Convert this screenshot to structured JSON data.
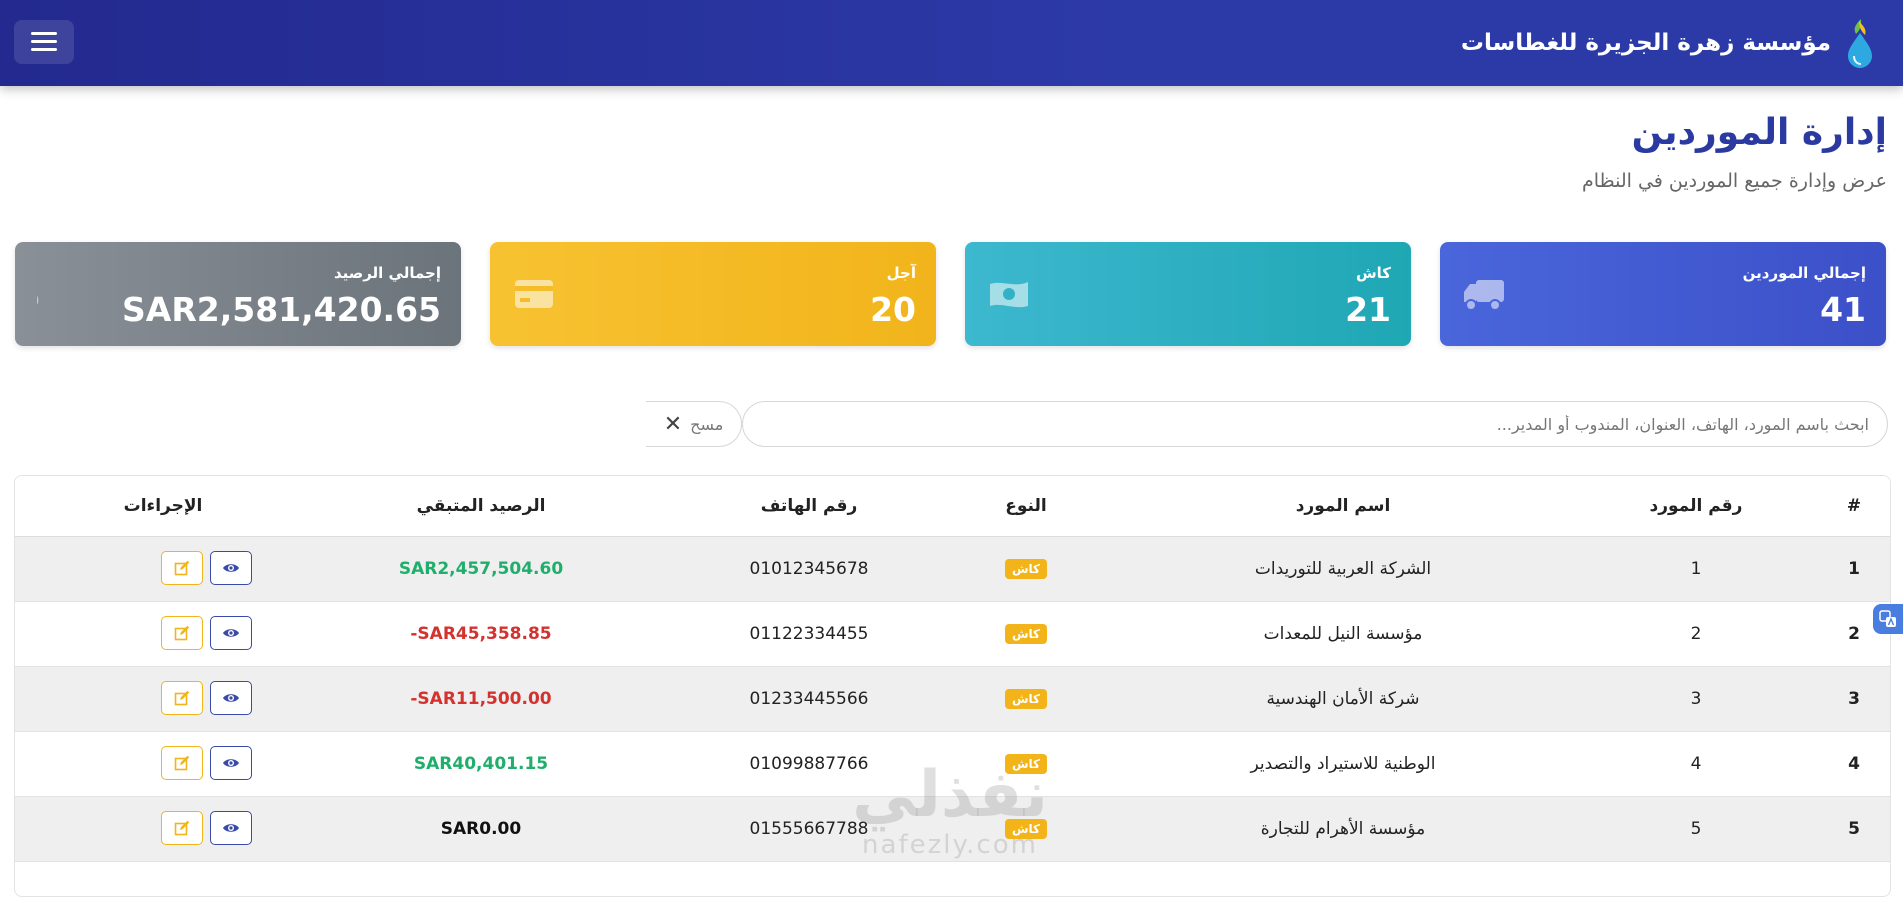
{
  "app": {
    "brand_name": "مؤسسة زهرة الجزيرة للغطاسات",
    "colors": {
      "primary": "#2c3aa8",
      "success": "#1fae6b",
      "danger": "#d3322e",
      "warning": "#f2b418"
    }
  },
  "page": {
    "title": "إدارة الموردين",
    "subtitle": "عرض وإدارة جميع الموردين في النظام"
  },
  "stats": [
    {
      "label": "إجمالي الموردين",
      "value": "41",
      "icon": "truck-icon",
      "color": "#4a66db"
    },
    {
      "label": "كاش",
      "value": "21",
      "icon": "money-bill-icon",
      "color": "#2fb0c3"
    },
    {
      "label": "آجل",
      "value": "20",
      "icon": "credit-card-icon",
      "color": "#f4bb25"
    },
    {
      "label": "إجمالي الرصيد",
      "value": "SAR2,581,420.65",
      "icon": "dollar-icon",
      "color": "#7a8188"
    }
  ],
  "search": {
    "placeholder": "ابحث باسم المورد، الهاتف، العنوان، المندوب أو المدير...",
    "value": "",
    "clear_label": "مسح"
  },
  "table": {
    "columns": {
      "index": "#",
      "supplier_number": "رقم المورد",
      "supplier_name": "اسم المورد",
      "type": "النوع",
      "phone": "رقم الهاتف",
      "balance": "الرصيد المتبقي",
      "actions": "الإجراءات"
    },
    "rows": [
      {
        "index": "1",
        "number": "1",
        "name": "الشركة العربية للتوريدات",
        "type": "كاش",
        "phone": "01012345678",
        "balance": "SAR2,457,504.60",
        "balance_status": "positive"
      },
      {
        "index": "2",
        "number": "2",
        "name": "مؤسسة النيل للمعدات",
        "type": "كاش",
        "phone": "01122334455",
        "balance": "-SAR45,358.85",
        "balance_status": "negative"
      },
      {
        "index": "3",
        "number": "3",
        "name": "شركة الأمان الهندسية",
        "type": "كاش",
        "phone": "01233445566",
        "balance": "-SAR11,500.00",
        "balance_status": "negative"
      },
      {
        "index": "4",
        "number": "4",
        "name": "الوطنية للاستيراد والتصدير",
        "type": "كاش",
        "phone": "01099887766",
        "balance": "SAR40,401.15",
        "balance_status": "positive"
      },
      {
        "index": "5",
        "number": "5",
        "name": "مؤسسة الأهرام للتجارة",
        "type": "كاش",
        "phone": "01555667788",
        "balance": "SAR0.00",
        "balance_status": "zero"
      }
    ]
  },
  "watermark": {
    "arabic": "نفذلي",
    "latin": "nafezly.com"
  }
}
